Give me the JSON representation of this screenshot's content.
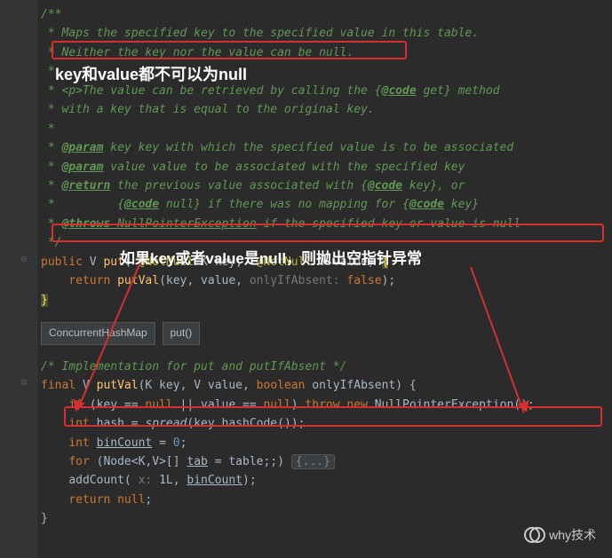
{
  "javadoc": {
    "l1": "/**",
    "l2": " * Maps the specified key to the specified value in this table.",
    "l3": " * Neither the key nor the value can be null.",
    "l4": " *",
    "l5": " * <p>The value can be retrieved by calling the {",
    "l5b": " get} method",
    "l6": " * with a key that is equal to the original key.",
    "l7": " *",
    "l8_prefix": " * ",
    "l8_tag": "@param",
    "l8_rest": " key key with which the specified value is to be associated",
    "l9_prefix": " * ",
    "l9_tag": "@param",
    "l9_rest": " value value to be associated with the specified key",
    "l10_prefix": " * ",
    "l10_tag": "@return",
    "l10_rest": " the previous value associated with {",
    "l10_rest2": " key}, or",
    "l11_prefix": " *         {",
    "l11_rest": " null} if there was no mapping for {",
    "l11_rest2": " key}",
    "l12_prefix": " * ",
    "l12_tag": "@throws",
    "l12_mid": " NullPointerException",
    "l12_rest": " if the specified key or value is null",
    "l13": " */",
    "code_tag": "@code"
  },
  "put": {
    "kw_public": "public",
    "ret_type": "V",
    "method": "put",
    "ann": "@NotNull",
    "ktype": "K",
    "kname": "key",
    "vtype": "V",
    "vname": "value",
    "kw_return": "return",
    "call": "putVal",
    "named_param": "onlyIfAbsent:",
    "false_val": "false"
  },
  "breadcrumb": {
    "a": "ConcurrentHashMap",
    "b": "put()"
  },
  "impl": {
    "comment": "/* Implementation for put and putIfAbsent */",
    "kw_final": "final",
    "ret": "V",
    "method": "putVal",
    "p1t": "K",
    "p1n": "key",
    "p2t": "V",
    "p2n": "value",
    "p3t": "boolean",
    "p3n": "onlyIfAbsent",
    "if_line_a": "if",
    "if_line_b": " (key == ",
    "if_line_c": "null",
    "if_line_d": " || value == ",
    "if_line_e": "null",
    "if_line_f": ") ",
    "if_line_g": "throw new",
    "if_line_h": " NullPointerException();",
    "hash_a": "int",
    "hash_b": " hash = ",
    "hash_c": "spread",
    "hash_d": "(key.hashCode());",
    "bin_a": "int",
    "bin_b": "binCount",
    "bin_c": " = ",
    "bin_d": "0",
    "for_a": "for",
    "for_b": " (Node<",
    "for_c": "K",
    "for_d": ",",
    "for_e": "V",
    "for_f": ">[] ",
    "for_g": "tab",
    "for_h": " = table;;) ",
    "for_fold": "{...}",
    "add_a": "addCount( ",
    "add_b": "x:",
    "add_c": " 1L, ",
    "add_d": "binCount",
    "add_e": ");",
    "ret_a": "return null",
    "ret_b": ";"
  },
  "annotations": {
    "a1": "key和value都不可以为null",
    "a2": "如果key或者value是null，则抛出空指针异常"
  },
  "watermark": "why技术"
}
